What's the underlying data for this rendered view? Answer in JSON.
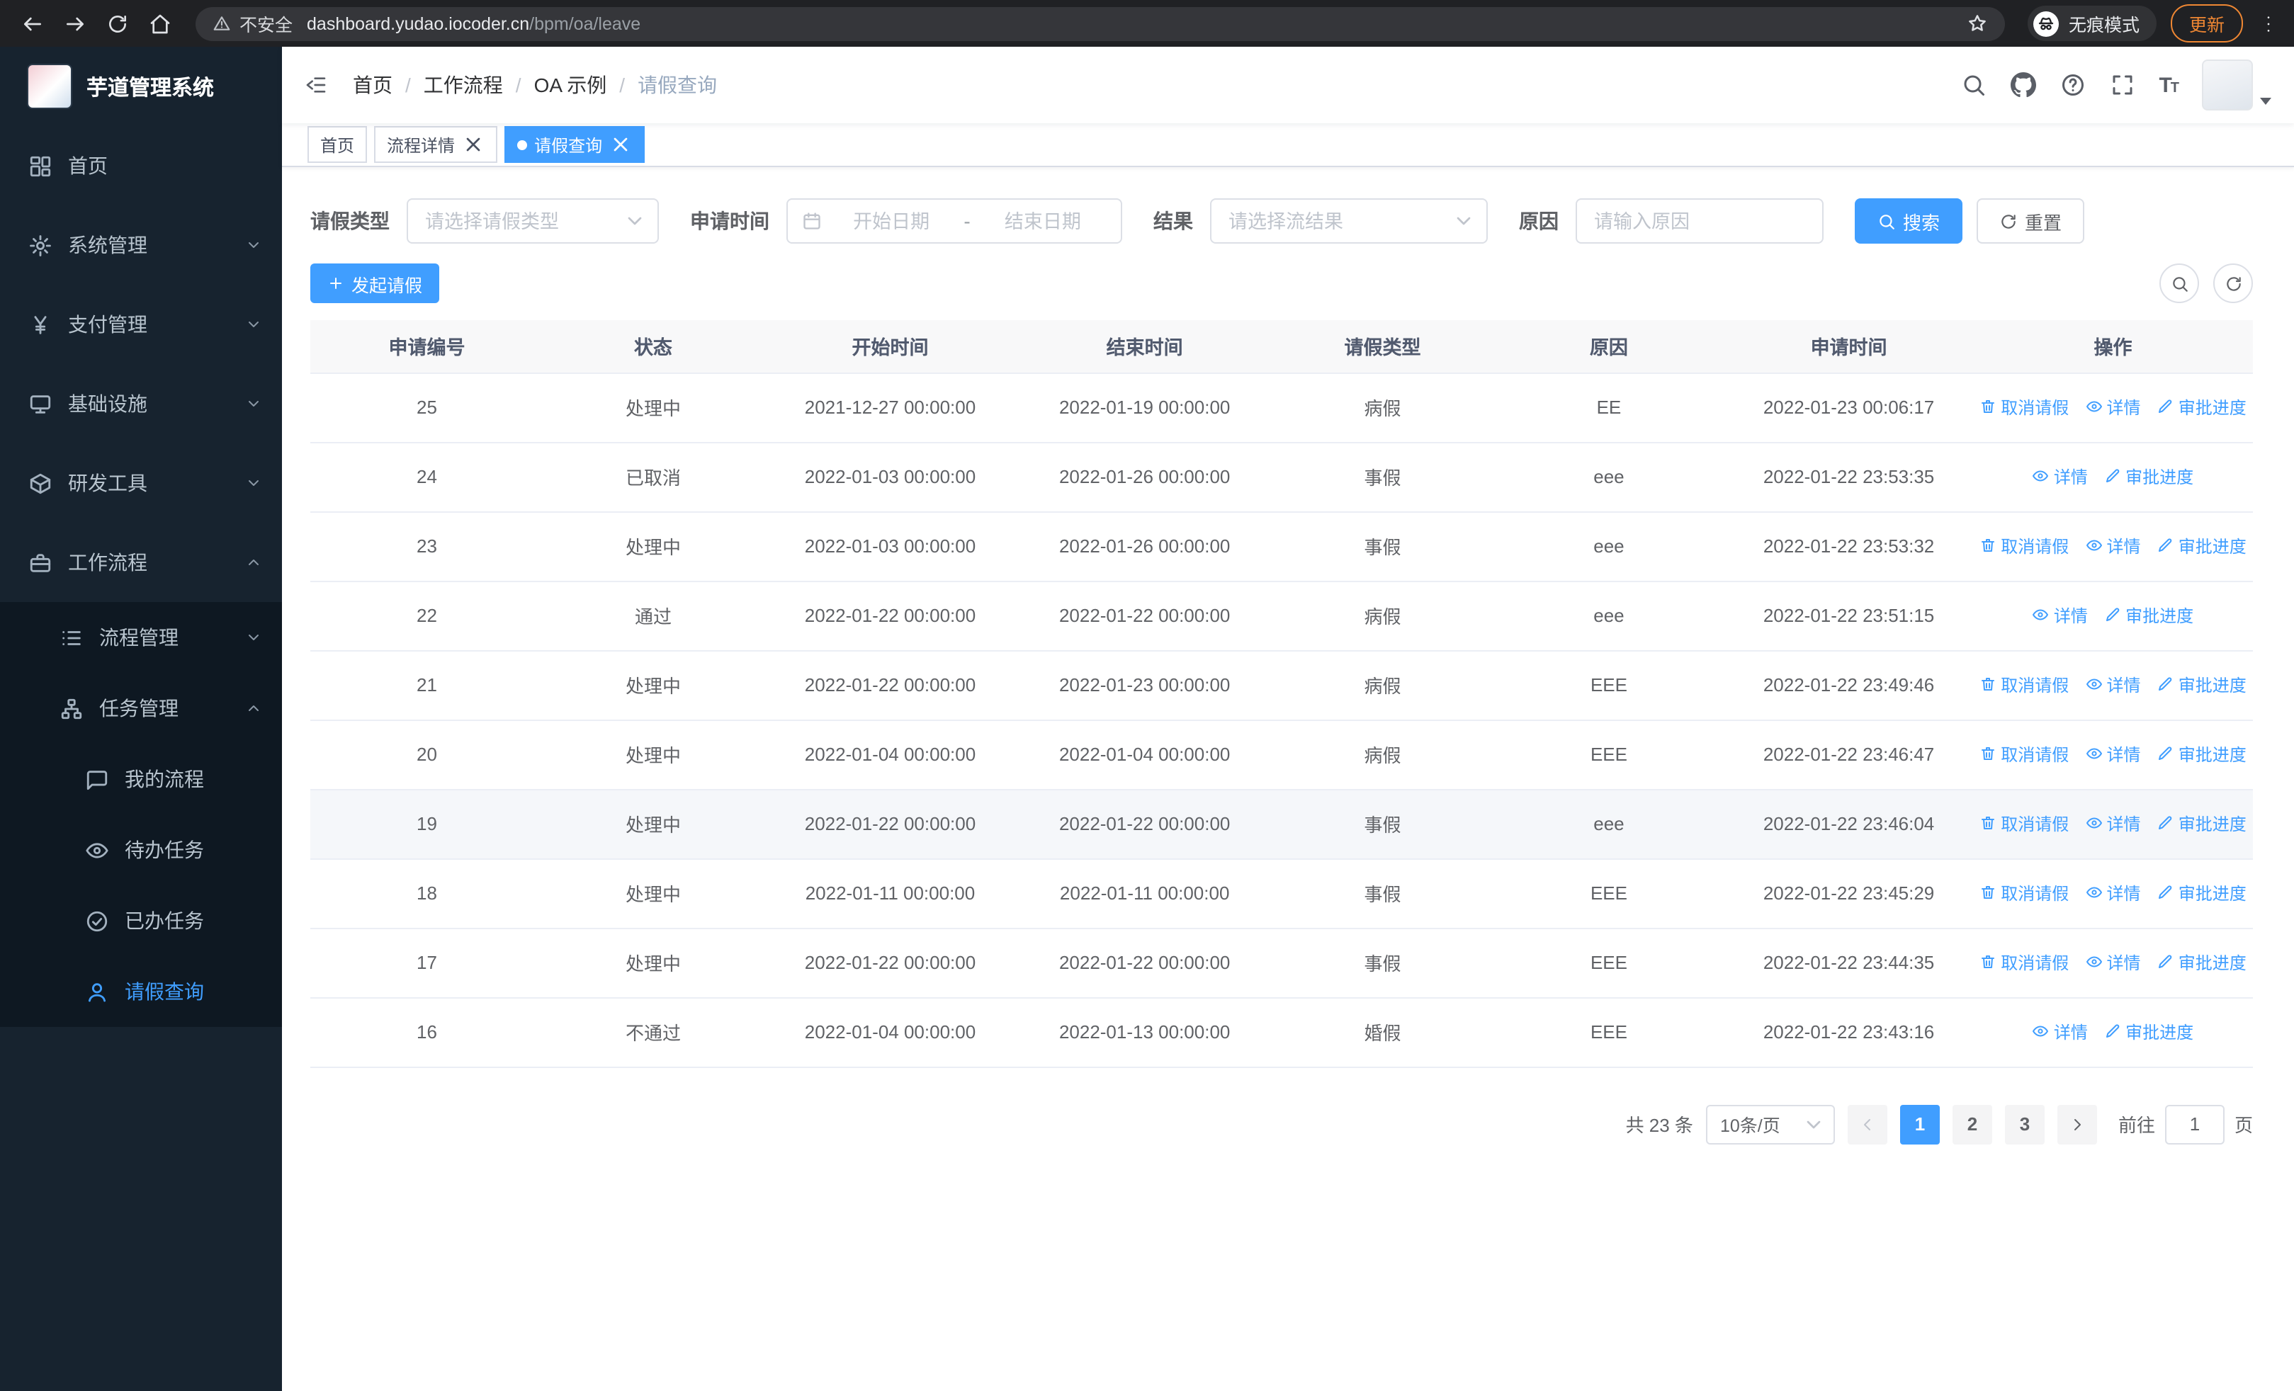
{
  "theme": {
    "accent": "#409eff"
  },
  "browser": {
    "security_label": "不安全",
    "url_domain": "dashboard.yudao.iocoder.cn",
    "url_path": "/bpm/oa/leave",
    "incognito_label": "无痕模式",
    "update_label": "更新"
  },
  "sidebar": {
    "logo_title": "芋道管理系统",
    "items": [
      {
        "label": "首页",
        "icon": "dashboard-icon",
        "level": 1
      },
      {
        "label": "系统管理",
        "icon": "gear-icon",
        "level": 1,
        "chevron": "down"
      },
      {
        "label": "支付管理",
        "icon": "payment-icon",
        "level": 1,
        "chevron": "down"
      },
      {
        "label": "基础设施",
        "icon": "infrastructure-icon",
        "level": 1,
        "chevron": "down"
      },
      {
        "label": "研发工具",
        "icon": "devtools-icon",
        "level": 1,
        "chevron": "down"
      },
      {
        "label": "工作流程",
        "icon": "workflow-icon",
        "level": 1,
        "chevron": "up",
        "expanded": true
      },
      {
        "label": "流程管理",
        "icon": "process-management-icon",
        "level": 2,
        "chevron": "down"
      },
      {
        "label": "任务管理",
        "icon": "task-management-icon",
        "level": 2,
        "chevron": "up",
        "expanded": true
      },
      {
        "label": "我的流程",
        "icon": "my-process-icon",
        "level": 3
      },
      {
        "label": "待办任务",
        "icon": "todo-task-icon",
        "level": 3
      },
      {
        "label": "已办任务",
        "icon": "done-task-icon",
        "level": 3
      },
      {
        "label": "请假查询",
        "icon": "leave-query-icon",
        "level": 3,
        "active": true
      }
    ]
  },
  "header": {
    "separator": "/",
    "breadcrumb": [
      "首页",
      "工作流程",
      "OA 示例",
      "请假查询"
    ]
  },
  "tabs": {
    "items": [
      {
        "label": "首页",
        "closable": false,
        "active": false
      },
      {
        "label": "流程详情",
        "closable": true,
        "active": false
      },
      {
        "label": "请假查询",
        "closable": true,
        "active": true
      }
    ]
  },
  "filters": {
    "leave_type": {
      "label": "请假类型",
      "placeholder": "请选择请假类型"
    },
    "apply_time": {
      "label": "申请时间",
      "start_placeholder": "开始日期",
      "separator": "-",
      "end_placeholder": "结束日期"
    },
    "result": {
      "label": "结果",
      "placeholder": "请选择流结果"
    },
    "reason": {
      "label": "原因",
      "placeholder": "请输入原因"
    },
    "search_label": "搜索",
    "reset_label": "重置"
  },
  "toolbar": {
    "create_label": "发起请假"
  },
  "table": {
    "columns": [
      "申请编号",
      "状态",
      "开始时间",
      "结束时间",
      "请假类型",
      "原因",
      "申请时间",
      "操作"
    ],
    "action_labels": {
      "cancel": "取消请假",
      "detail": "详情",
      "progress": "审批进度"
    },
    "rows": [
      {
        "id": "25",
        "status": "处理中",
        "start": "2021-12-27 00:00:00",
        "end": "2022-01-19 00:00:00",
        "type": "病假",
        "reason": "EE",
        "apply_time": "2022-01-23 00:06:17",
        "cancelable": true
      },
      {
        "id": "24",
        "status": "已取消",
        "start": "2022-01-03 00:00:00",
        "end": "2022-01-26 00:00:00",
        "type": "事假",
        "reason": "eee",
        "apply_time": "2022-01-22 23:53:35",
        "cancelable": false
      },
      {
        "id": "23",
        "status": "处理中",
        "start": "2022-01-03 00:00:00",
        "end": "2022-01-26 00:00:00",
        "type": "事假",
        "reason": "eee",
        "apply_time": "2022-01-22 23:53:32",
        "cancelable": true
      },
      {
        "id": "22",
        "status": "通过",
        "start": "2022-01-22 00:00:00",
        "end": "2022-01-22 00:00:00",
        "type": "病假",
        "reason": "eee",
        "apply_time": "2022-01-22 23:51:15",
        "cancelable": false
      },
      {
        "id": "21",
        "status": "处理中",
        "start": "2022-01-22 00:00:00",
        "end": "2022-01-23 00:00:00",
        "type": "病假",
        "reason": "EEE",
        "apply_time": "2022-01-22 23:49:46",
        "cancelable": true
      },
      {
        "id": "20",
        "status": "处理中",
        "start": "2022-01-04 00:00:00",
        "end": "2022-01-04 00:00:00",
        "type": "病假",
        "reason": "EEE",
        "apply_time": "2022-01-22 23:46:47",
        "cancelable": true
      },
      {
        "id": "19",
        "status": "处理中",
        "start": "2022-01-22 00:00:00",
        "end": "2022-01-22 00:00:00",
        "type": "事假",
        "reason": "eee",
        "apply_time": "2022-01-22 23:46:04",
        "cancelable": true,
        "highlighted": true
      },
      {
        "id": "18",
        "status": "处理中",
        "start": "2022-01-11 00:00:00",
        "end": "2022-01-11 00:00:00",
        "type": "事假",
        "reason": "EEE",
        "apply_time": "2022-01-22 23:45:29",
        "cancelable": true
      },
      {
        "id": "17",
        "status": "处理中",
        "start": "2022-01-22 00:00:00",
        "end": "2022-01-22 00:00:00",
        "type": "事假",
        "reason": "EEE",
        "apply_time": "2022-01-22 23:44:35",
        "cancelable": true
      },
      {
        "id": "16",
        "status": "不通过",
        "start": "2022-01-04 00:00:00",
        "end": "2022-01-13 00:00:00",
        "type": "婚假",
        "reason": "EEE",
        "apply_time": "2022-01-22 23:43:16",
        "cancelable": false
      }
    ]
  },
  "pagination": {
    "total_label": "共 23 条",
    "page_size_label": "10条/页",
    "pages": [
      "1",
      "2",
      "3"
    ],
    "active_page": "1",
    "goto_label": "前往",
    "goto_value": "1",
    "goto_suffix_label": "页"
  }
}
